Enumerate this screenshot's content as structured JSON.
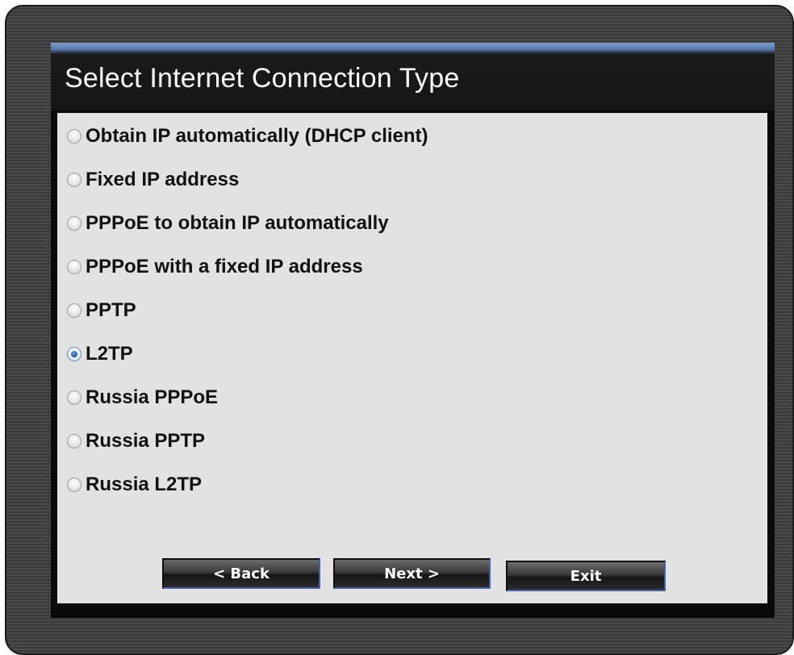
{
  "header": {
    "title": "Select Internet Connection Type"
  },
  "options": [
    {
      "label": "Obtain IP automatically (DHCP client)",
      "selected": false
    },
    {
      "label": "Fixed IP address",
      "selected": false
    },
    {
      "label": "PPPoE to obtain IP automatically",
      "selected": false
    },
    {
      "label": "PPPoE with a fixed IP address",
      "selected": false
    },
    {
      "label": "PPTP",
      "selected": false
    },
    {
      "label": "L2TP",
      "selected": true
    },
    {
      "label": "Russia PPPoE",
      "selected": false
    },
    {
      "label": "Russia PPTP",
      "selected": false
    },
    {
      "label": "Russia L2TP",
      "selected": false
    }
  ],
  "buttons": {
    "back": "< Back",
    "next": "Next >",
    "exit": "Exit"
  },
  "colors": {
    "header_accent": "#6b8cc4",
    "content_bg": "#e2e2e2",
    "button_border_accent": "#4763a8"
  }
}
